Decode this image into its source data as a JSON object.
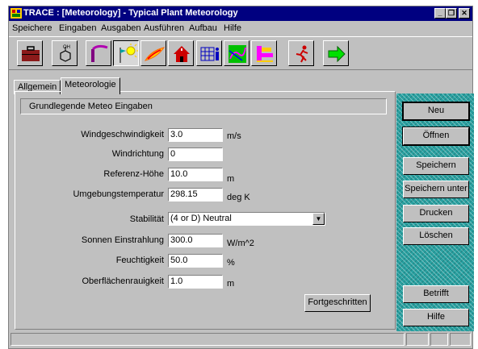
{
  "window": {
    "title": "TRACE : [Meteorology] - Typical Plant Meteorology",
    "caption_buttons": [
      "minimize-icon",
      "restore-icon",
      "close-icon"
    ]
  },
  "menu": [
    "Speichere",
    "Eingaben",
    "Ausgaben",
    "Ausführen",
    "Aufbau",
    "Hilfe"
  ],
  "toolbar": {
    "icons": [
      "briefcase-icon",
      "chemical-icon",
      "stack-plume-icon",
      "weather-sun-icon",
      "plume-icon",
      "building-icon",
      "grid-person-icon",
      "map-icon",
      "blocks-icon",
      "running-person-icon",
      "arrow-right-icon"
    ]
  },
  "tabs": [
    {
      "label": "Allgemein",
      "active": false
    },
    {
      "label": "Meteorologie",
      "active": true
    }
  ],
  "group": {
    "title": "Grundlegende Meteo Eingaben"
  },
  "fields": [
    {
      "label": "Windgeschwindigkeit",
      "value": "3.0",
      "unit": "m/s"
    },
    {
      "label": "Windrichtung",
      "value": "0",
      "unit": ""
    },
    {
      "label": "Referenz-Höhe",
      "value": "10.0",
      "unit": "m"
    },
    {
      "label": "Umgebungstemperatur",
      "value": "298.15",
      "unit": "deg K"
    }
  ],
  "stability": {
    "label": "Stabilität",
    "value": "(4 or D) Neutral"
  },
  "fields2": [
    {
      "label": "Sonnen Einstrahlung",
      "value": "300.0",
      "unit": "W/m^2"
    },
    {
      "label": "Feuchtigkeit",
      "value": "50.0",
      "unit": "%"
    },
    {
      "label": "Oberflächenrauigkeit",
      "value": "1.0",
      "unit": "m"
    }
  ],
  "advanced_button": "Fortgeschritten",
  "side_buttons": [
    "Neu",
    "Öffnen",
    "Speichern",
    "Speichern unter",
    "Drucken",
    "Löschen"
  ],
  "bottom_buttons": [
    "Betrifft",
    "Hilfe"
  ],
  "colors": {
    "titlebar": "#000080",
    "sidebar": "#28a0a0",
    "face": "#c0c0c0"
  }
}
